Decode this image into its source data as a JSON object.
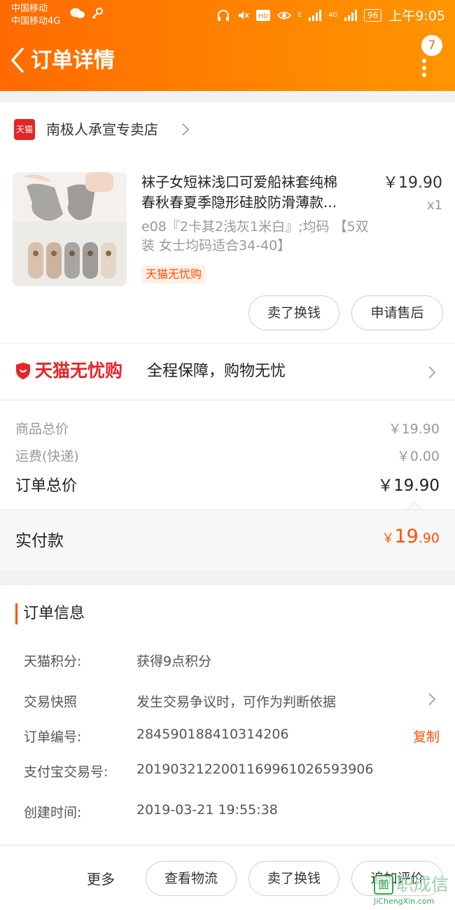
{
  "status_bar": {
    "carrier_1": "中国移动",
    "carrier_2": "中国移动4G",
    "battery": "96",
    "time": "上午9:05",
    "signal_1_label": "E",
    "signal_2_label": "4G"
  },
  "nav": {
    "title": "订单详情",
    "badge_count": "7"
  },
  "store": {
    "logo_text": "天猫",
    "name": "南极人承宣专卖店"
  },
  "product": {
    "title_line_1": "袜子女短袜浅口可爱船袜套纯棉",
    "title_line_2": "春秋春夏季隐形硅胶防滑薄款...",
    "price": "￥19.90",
    "quantity": "x1",
    "sku": "e08『2卡其2浅灰1米白』;均码 【5双装 女士均码适合34-40】",
    "tag": "天猫无忧购"
  },
  "actions": {
    "sell_exchange": "卖了换钱",
    "after_sales": "申请售后"
  },
  "wuyou": {
    "brand": "天猫无忧购",
    "slogan": "全程保障，购物无忧"
  },
  "prices": {
    "goods_label": "商品总价",
    "goods_value": "￥19.90",
    "shipping_label": "运费(快递)",
    "shipping_value": "￥0.00",
    "total_label": "订单总价",
    "total_value": "￥19.90"
  },
  "paid": {
    "label": "实付款",
    "currency": "￥",
    "integer": "19",
    "decimal": ".90"
  },
  "order_info": {
    "title": "订单信息",
    "rows": [
      {
        "label": "天猫积分:",
        "value": "获得9点积分"
      },
      {
        "label": "交易快照",
        "value": "发生交易争议时，可作为判断依据"
      },
      {
        "label": "订单编号:",
        "value": "284590188410314206"
      },
      {
        "label": "支付宝交易号:",
        "value": "2019032122001169961026593906"
      },
      {
        "label": "创建时间:",
        "value": "2019-03-21 19:55:38"
      }
    ],
    "copy_label": "复制"
  },
  "bottom_bar": {
    "more": "更多",
    "view_logistics": "查看物流",
    "sell_exchange": "卖了换钱",
    "add_review": "追加评价"
  },
  "watermark": {
    "mark": "圜",
    "text": "职成信",
    "url": "JiChengXin.com"
  },
  "colors": {
    "accent": "#ff5000",
    "header_start": "#ff6a00",
    "header_end": "#ff9400",
    "tmall_red": "#e5252a"
  }
}
